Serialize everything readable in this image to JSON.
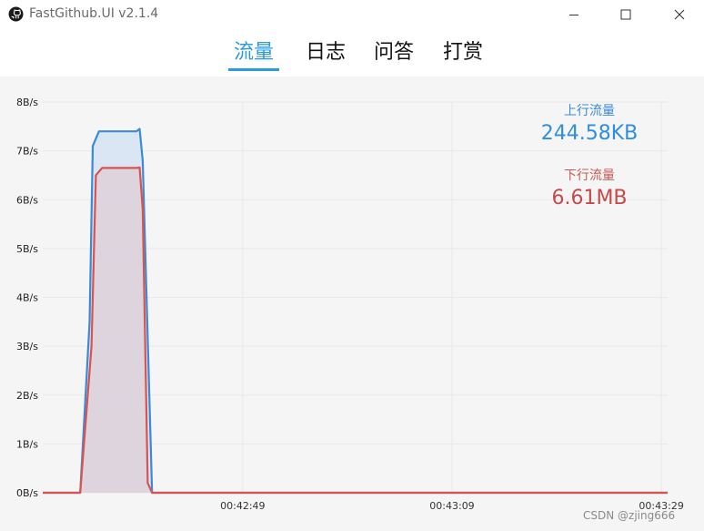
{
  "window": {
    "title": "FastGithub.UI v2.1.4",
    "app_icon": "github-icon",
    "controls": [
      "minimize-icon",
      "maximize-icon",
      "close-icon"
    ]
  },
  "tabs": [
    {
      "label": "流量",
      "active": true
    },
    {
      "label": "日志",
      "active": false
    },
    {
      "label": "问答",
      "active": false
    },
    {
      "label": "打赏",
      "active": false
    }
  ],
  "stats": {
    "upload_label": "上行流量",
    "upload_value": "244.58KB",
    "download_label": "下行流量",
    "download_value": "6.61MB"
  },
  "watermark": "CSDN @zjing666",
  "colors": {
    "accent": "#2b9be0",
    "upload": "#3b8ad9",
    "download": "#d9534f",
    "chart_bg": "#f5f5f5"
  },
  "chart_data": {
    "type": "area",
    "y_ticks": [
      "8B/s",
      "7B/s",
      "6B/s",
      "5B/s",
      "4B/s",
      "3B/s",
      "2B/s",
      "1B/s",
      "0B/s"
    ],
    "ylim": [
      0,
      8
    ],
    "x_ticks": [
      "00:42:49",
      "00:43:09",
      "00:43:29"
    ],
    "grid": true,
    "legend_position": "top-right",
    "series": [
      {
        "name": "上行流量",
        "color": "#3b8ad9",
        "fill": "#d5e3f3",
        "x": [
          0,
          0.04,
          0.06,
          0.075,
          0.08,
          0.09,
          0.1,
          0.15,
          0.155,
          0.16,
          0.175,
          0.2,
          1.0
        ],
        "values": [
          0,
          0,
          0,
          3.5,
          7.1,
          7.4,
          7.4,
          7.4,
          7.45,
          6.8,
          0,
          0,
          0
        ]
      },
      {
        "name": "下行流量",
        "color": "#d9534f",
        "fill": "#ddd0d9",
        "x": [
          0,
          0.04,
          0.06,
          0.078,
          0.085,
          0.095,
          0.1,
          0.15,
          0.155,
          0.16,
          0.168,
          0.175,
          1.0
        ],
        "values": [
          0,
          0,
          0,
          3.0,
          6.5,
          6.65,
          6.65,
          6.65,
          6.66,
          5.8,
          0.2,
          0,
          0
        ]
      }
    ]
  }
}
